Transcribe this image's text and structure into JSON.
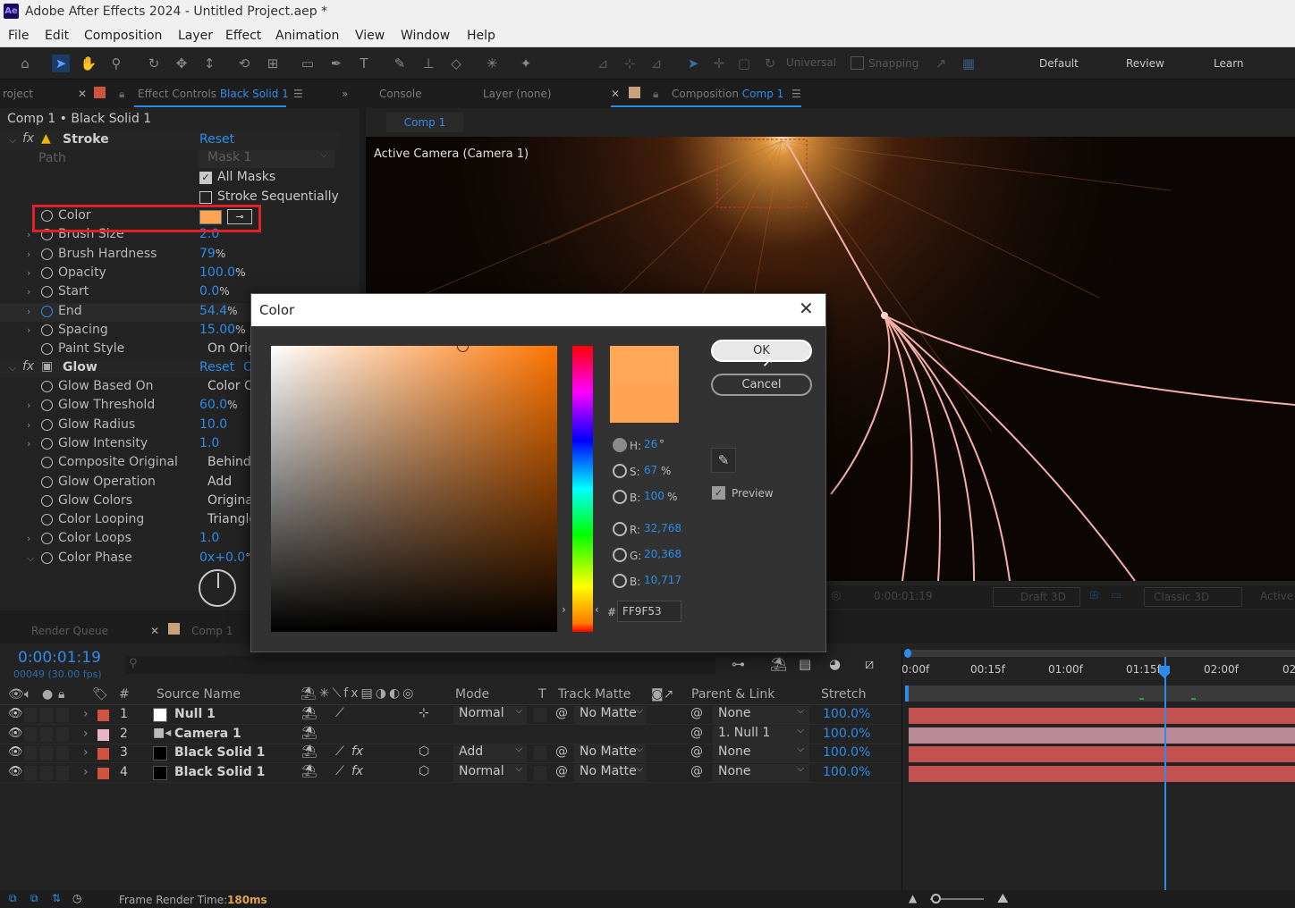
{
  "window": {
    "title": "Adobe After Effects 2024 - Untitled Project.aep *",
    "app_badge": "Ae"
  },
  "menu": [
    "File",
    "Edit",
    "Composition",
    "Layer",
    "Effect",
    "Animation",
    "View",
    "Window",
    "Help"
  ],
  "toolbar": {
    "universal": "Universal",
    "snapping": "Snapping",
    "workspaces": [
      "Default",
      "Review",
      "Learn"
    ]
  },
  "left_panel": {
    "tab_project": "roject",
    "tab_effect_prefix": "Effect Controls",
    "tab_effect_layer": "Black Solid 1",
    "breadcrumb": "Comp 1 • Black Solid 1",
    "stroke": {
      "name": "Stroke",
      "reset": "Reset",
      "path_label": "Path",
      "path_value": "Mask 1",
      "all_masks": "All Masks",
      "stroke_seq": "Stroke Sequentially",
      "props": [
        {
          "label": "Color",
          "value": ""
        },
        {
          "label": "Brush Size",
          "value": "2.0"
        },
        {
          "label": "Brush Hardness",
          "value": "79",
          "unit": "%"
        },
        {
          "label": "Opacity",
          "value": "100.0",
          "unit": "%"
        },
        {
          "label": "Start",
          "value": "0.0",
          "unit": "%"
        },
        {
          "label": "End",
          "value": "54.4",
          "unit": "%"
        },
        {
          "label": "Spacing",
          "value": "15.00",
          "unit": "%"
        },
        {
          "label": "Paint Style",
          "value": "On Orig"
        }
      ]
    },
    "glow": {
      "name": "Glow",
      "reset": "Reset",
      "options": "O",
      "props": [
        {
          "label": "Glow Based On",
          "value": "Color Cl"
        },
        {
          "label": "Glow Threshold",
          "value": "60.0",
          "unit": "%"
        },
        {
          "label": "Glow Radius",
          "value": "10.0"
        },
        {
          "label": "Glow Intensity",
          "value": "1.0"
        },
        {
          "label": "Composite Original",
          "value": "Behind"
        },
        {
          "label": "Glow Operation",
          "value": "Add"
        },
        {
          "label": "Glow Colors",
          "value": "Original"
        },
        {
          "label": "Color Looping",
          "value": "Triangle"
        },
        {
          "label": "Color Loops",
          "value": "1.0"
        },
        {
          "label": "Color Phase",
          "value": "0",
          "value2": "x+0.0",
          "unit": "°"
        }
      ]
    }
  },
  "viewer": {
    "tab_console": "Console",
    "tab_layer": "Layer (none)",
    "tab_comp_prefix": "Composition",
    "tab_comp": "Comp 1",
    "subtab": "Comp 1",
    "camera_label": "Active Camera (Camera 1)",
    "time": "0:00:01:19",
    "draft": "Draft 3D",
    "renderer": "Classic 3D",
    "active": "Active"
  },
  "color_dialog": {
    "title": "Color",
    "ok": "OK",
    "cancel": "Cancel",
    "preview": "Preview",
    "h": "26",
    "h_unit": "°",
    "s": "67",
    "s_unit": "%",
    "b": "100",
    "b_unit": "%",
    "r": "32,768",
    "g": "20,368",
    "b2": "10,717",
    "hex_prefix": "#",
    "hex": "FF9F53",
    "labels": {
      "h": "H:",
      "s": "S:",
      "b": "B:",
      "r": "R:",
      "g": "G:",
      "b2": "B:"
    },
    "color_new": "#ffa857",
    "color_old": "#ffa453"
  },
  "timeline": {
    "tab_render": "Render Queue",
    "tab_comp": "Comp 1",
    "timecode": "0:00:01:19",
    "fps": "00049 (30.00 fps)",
    "ruler": [
      "0:00f",
      "00:15f",
      "01:00f",
      "01:15f",
      "02:00f",
      "02"
    ],
    "headers": {
      "num": "#",
      "source": "Source Name",
      "mode": "Mode",
      "t": "T",
      "matte": "Track Matte",
      "parent": "Parent & Link",
      "stretch": "Stretch"
    },
    "layers": [
      {
        "num": "1",
        "name": "Null 1",
        "mode": "Normal",
        "matte": "No Matte",
        "parent": "None",
        "stretch": "100.0%",
        "color": "#d0533f",
        "swatch": "#ffffff",
        "bar": "#c25150"
      },
      {
        "num": "2",
        "name": "Camera 1",
        "mode": "",
        "matte": "",
        "parent": "1. Null 1",
        "stretch": "100.0%",
        "color": "#e7b5c3",
        "swatch": "",
        "bar": "#b98a97"
      },
      {
        "num": "3",
        "name": "Black Solid 1",
        "mode": "Add",
        "matte": "No Matte",
        "parent": "None",
        "stretch": "100.0%",
        "color": "#d0533f",
        "swatch": "#000000",
        "bar": "#c25150"
      },
      {
        "num": "4",
        "name": "Black Solid 1",
        "mode": "Normal",
        "matte": "No Matte",
        "parent": "None",
        "stretch": "100.0%",
        "color": "#d0533f",
        "swatch": "#000000",
        "bar": "#c25150"
      }
    ]
  },
  "status": {
    "label": "Frame Render Time:",
    "value": "180ms"
  },
  "colors": {
    "accent": "#2d8ceb",
    "highlight": "#e0202a",
    "swatch": "#ffa453"
  }
}
